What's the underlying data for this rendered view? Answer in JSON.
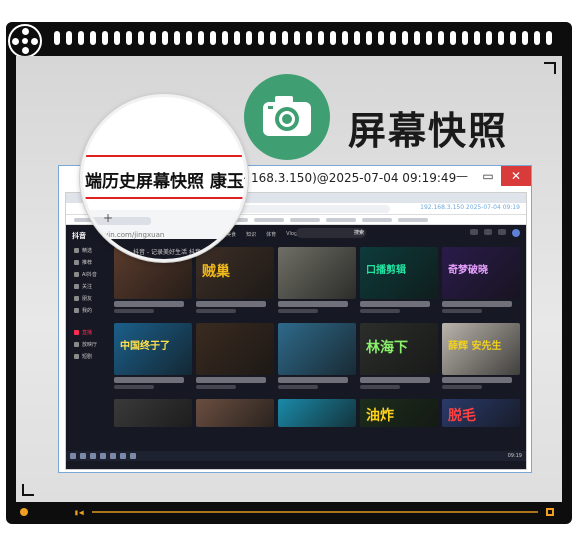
{
  "header": {
    "title": "屏幕快照",
    "camera_icon": "camera-icon",
    "accent_color": "#3f9f72"
  },
  "window": {
    "caption": "168.3.150)@2025-07-04 09:19:49",
    "minimize": "—",
    "maximize": "▭",
    "close": "✕"
  },
  "magnifier": {
    "text": "端历史屏幕快照 康玉涵",
    "tab_plus": "+",
    "url_text": "douyin.com/jingxuan",
    "app_name": "抖音",
    "tabs_text": "抖音 - 记录美好生活  抖音 - 全网热点"
  },
  "browser": {
    "watermark": "192.168.3.150 2025-07-04 09:19"
  },
  "douyin": {
    "logo": "抖音",
    "sidebar": [
      "精选",
      "推荐",
      "AI抖音",
      "关注",
      "朋友",
      "我的",
      "直播",
      "放映厅",
      "短剧"
    ],
    "top_nav": [
      "全部",
      "公开课",
      "游戏",
      "二次元",
      "音乐",
      "美食",
      "知识",
      "体育",
      "Vlog",
      "影视"
    ],
    "search_label": "搜索",
    "taskbar_time": "09:19"
  },
  "thumbnails": [
    {
      "text": "",
      "bg": "#5a3b2c"
    },
    {
      "text": "贼巢",
      "bg": "#3d2f26",
      "color": "#f1b81b"
    },
    {
      "text": "",
      "bg": "#6f6f66"
    },
    {
      "text": "口播剪辑",
      "bg": "#0d3b3b",
      "color": "#22e3a0"
    },
    {
      "text": "奇梦破晓",
      "bg": "#2a1b4a",
      "color": "#e8a1ff"
    },
    {
      "text": "中国终于了",
      "bg": "#1b5f8a",
      "color": "#ffe14a"
    },
    {
      "text": "",
      "bg": "#3a2b20"
    },
    {
      "text": "",
      "bg": "#2e6a8a"
    },
    {
      "text": "林海下",
      "bg": "#2b2e2b",
      "color": "#8af06a"
    },
    {
      "text": "薛辉 安先生",
      "bg": "#b9b4ab",
      "color": "#f0d020"
    },
    {
      "text": "",
      "bg": "#3a3a3a"
    },
    {
      "text": "",
      "bg": "#6a4e40"
    },
    {
      "text": "",
      "bg": "#1a8aa8"
    },
    {
      "text": "油炸",
      "bg": "#1c2e1c",
      "color": "#ffd21a"
    },
    {
      "text": "脱毛",
      "bg": "#2a3a6a",
      "color": "#ff4040"
    }
  ]
}
